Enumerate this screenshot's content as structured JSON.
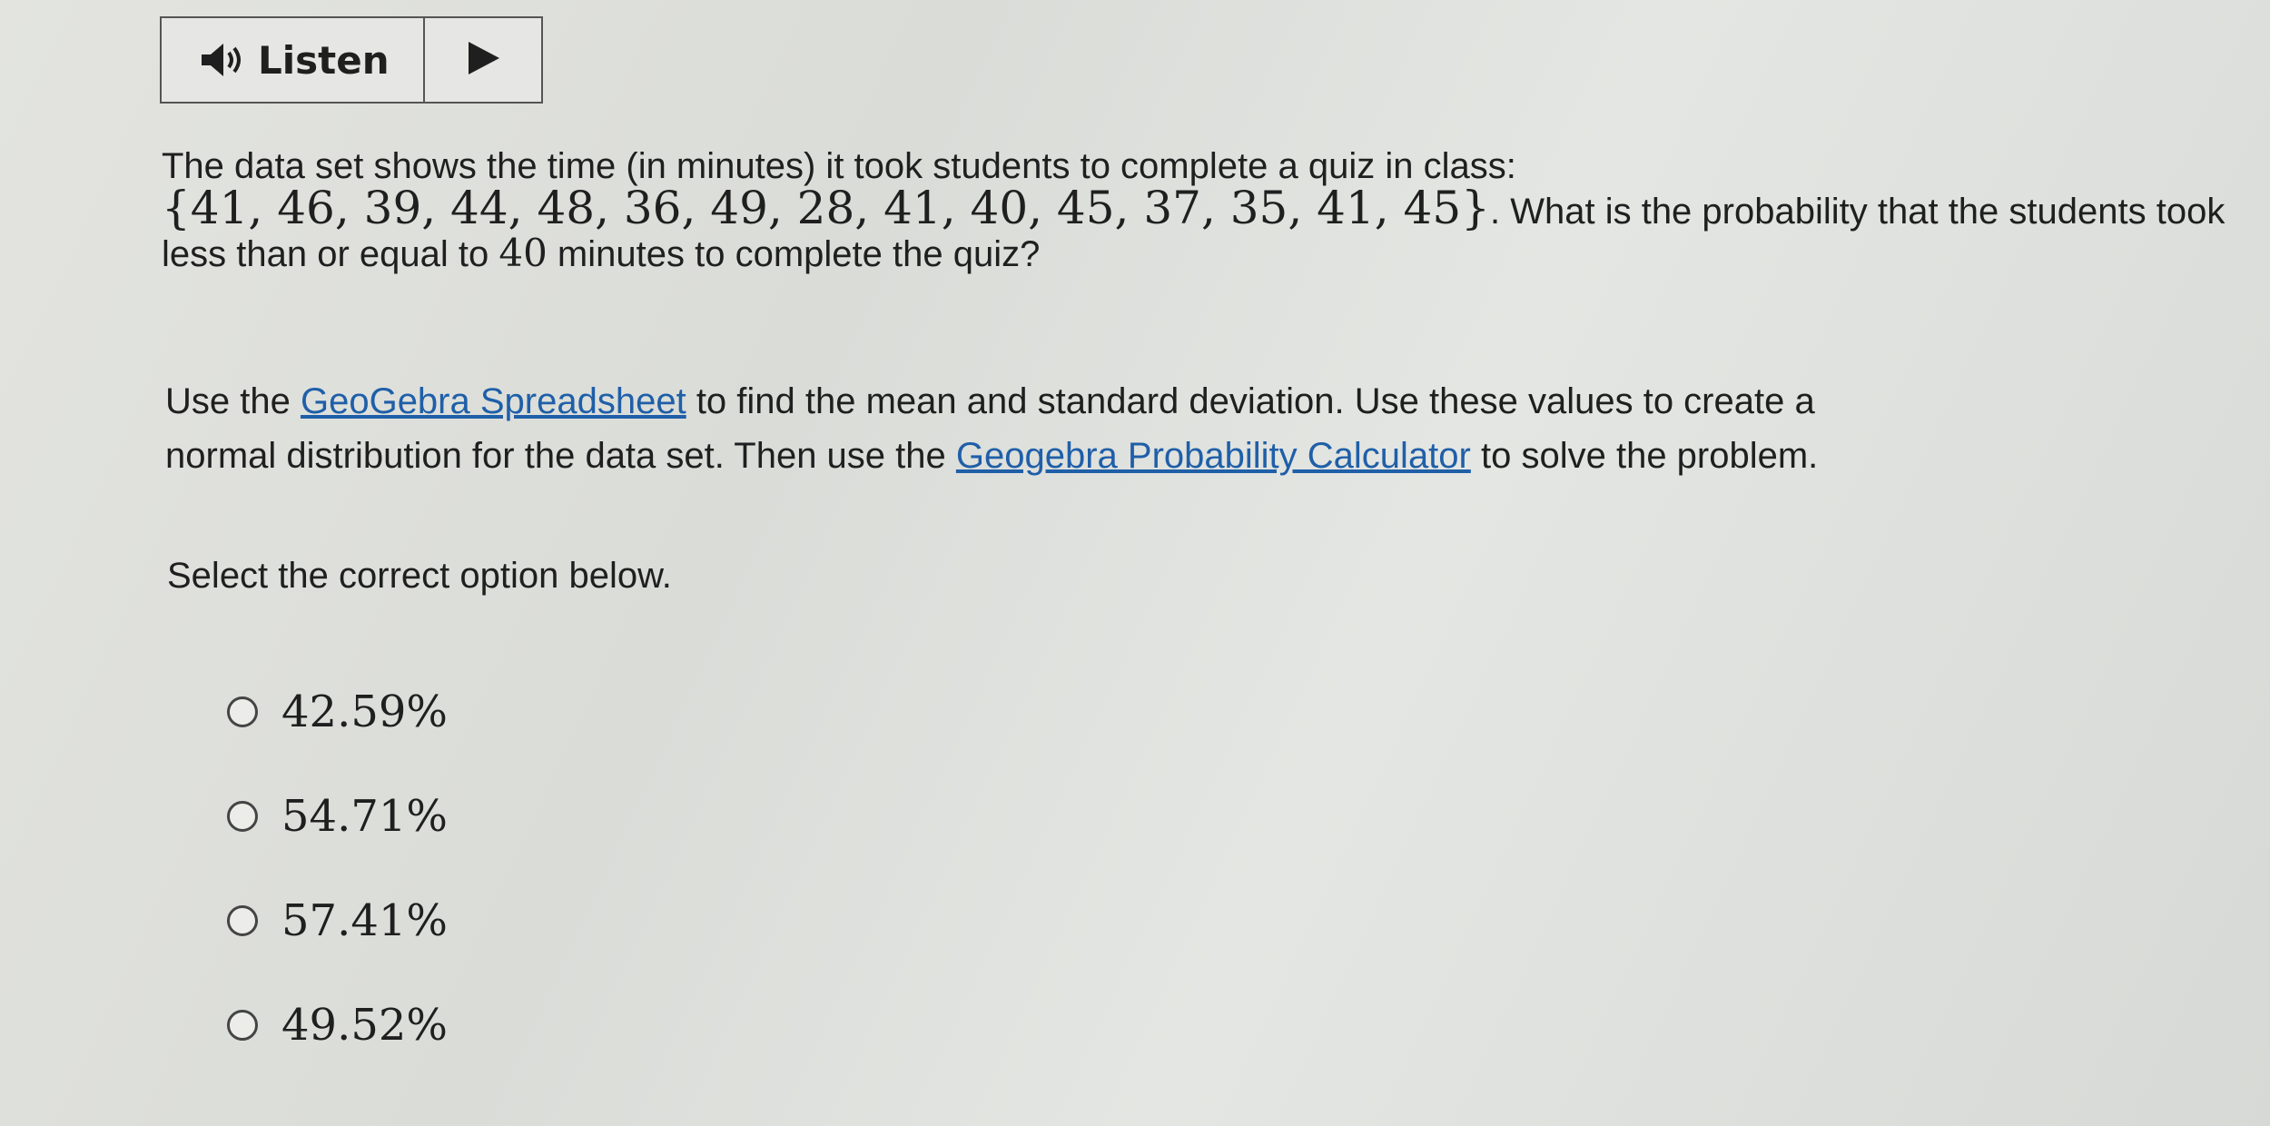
{
  "toolbar": {
    "listen_label": "Listen",
    "speaker_icon": "speaker-icon",
    "play_icon": "play-icon"
  },
  "question": {
    "line1": "The data set shows the time (in minutes) it took students to complete a quiz in class:",
    "dataset": "{41, 46, 39, 44, 48, 36, 49, 28, 41, 40, 45, 37, 35, 41, 45}",
    "line2_after": ". What is the probability that the students took",
    "line3_before": "less than or equal to ",
    "threshold": "40",
    "line3_after": " minutes to complete the quiz?"
  },
  "instructions": {
    "part1": "Use the ",
    "link1": "GeoGebra Spreadsheet",
    "part2": " to find the mean and standard deviation. Use these values to create a",
    "part3": "normal distribution for the data set. Then use the ",
    "link2": "Geogebra Probability Calculator",
    "part4": " to solve the problem."
  },
  "prompt": "Select the correct option below.",
  "options": [
    {
      "label": "42.59%",
      "selected": false
    },
    {
      "label": "54.71%",
      "selected": false
    },
    {
      "label": "57.41%",
      "selected": false
    },
    {
      "label": "49.52%",
      "selected": false
    }
  ],
  "colors": {
    "link": "#1f5fa8",
    "text": "#1f1f1f",
    "background": "#dedfdc"
  }
}
